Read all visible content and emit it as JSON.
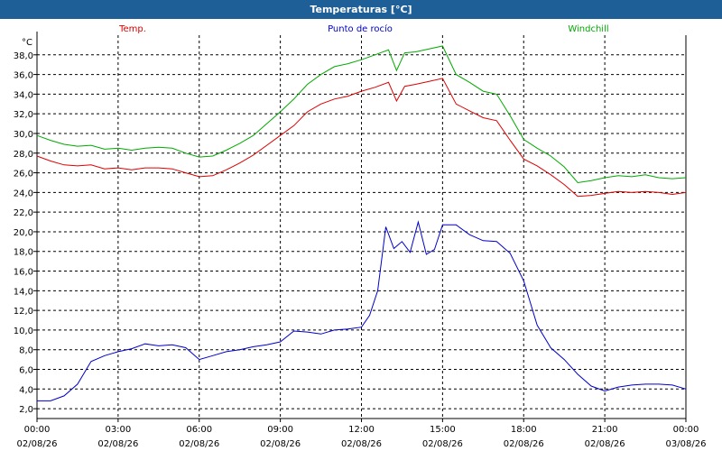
{
  "window": {
    "title": "Temperaturas [°C]"
  },
  "chart_data": {
    "type": "line",
    "unit_label": "°C",
    "ylim": [
      1,
      40
    ],
    "y_ticks": [
      2,
      4,
      6,
      8,
      10,
      12,
      14,
      16,
      18,
      20,
      22,
      24,
      26,
      28,
      30,
      32,
      34,
      36,
      38
    ],
    "y_tick_labels": [
      "2,0",
      "4,0",
      "6,0",
      "8,0",
      "10,0",
      "12,0",
      "14,0",
      "16,0",
      "18,0",
      "20,0",
      "22,0",
      "24,0",
      "26,0",
      "28,0",
      "30,0",
      "32,0",
      "34,0",
      "36,0",
      "38,0"
    ],
    "xlim": [
      0,
      24
    ],
    "x_ticks": [
      {
        "h": 0,
        "time": "00:00",
        "date": "02/08/26"
      },
      {
        "h": 3,
        "time": "03:00",
        "date": "02/08/26"
      },
      {
        "h": 6,
        "time": "06:00",
        "date": "02/08/26"
      },
      {
        "h": 9,
        "time": "09:00",
        "date": "02/08/26"
      },
      {
        "h": 12,
        "time": "12:00",
        "date": "02/08/26"
      },
      {
        "h": 15,
        "time": "15:00",
        "date": "02/08/26"
      },
      {
        "h": 18,
        "time": "18:00",
        "date": "02/08/26"
      },
      {
        "h": 21,
        "time": "21:00",
        "date": "02/08/26"
      },
      {
        "h": 24,
        "time": "00:00",
        "date": "03/08/26"
      }
    ],
    "grid": true,
    "series": [
      {
        "name": "Temp.",
        "color": "#dd0000",
        "points": [
          [
            0,
            27.7
          ],
          [
            0.5,
            27.2
          ],
          [
            1,
            26.8
          ],
          [
            1.5,
            26.7
          ],
          [
            2,
            26.8
          ],
          [
            2.5,
            26.4
          ],
          [
            3,
            26.5
          ],
          [
            3.5,
            26.3
          ],
          [
            4,
            26.5
          ],
          [
            4.5,
            26.5
          ],
          [
            5,
            26.4
          ],
          [
            5.5,
            26.0
          ],
          [
            6,
            25.6
          ],
          [
            6.5,
            25.7
          ],
          [
            7,
            26.3
          ],
          [
            7.5,
            27.0
          ],
          [
            8,
            27.8
          ],
          [
            8.5,
            28.8
          ],
          [
            9,
            29.8
          ],
          [
            9.5,
            30.8
          ],
          [
            10,
            32.2
          ],
          [
            10.5,
            33.0
          ],
          [
            11,
            33.5
          ],
          [
            11.5,
            33.8
          ],
          [
            12,
            34.3
          ],
          [
            12.5,
            34.7
          ],
          [
            13,
            35.2
          ],
          [
            13.3,
            33.3
          ],
          [
            13.6,
            34.8
          ],
          [
            14,
            35.0
          ],
          [
            14.5,
            35.3
          ],
          [
            15,
            35.6
          ],
          [
            15.5,
            33.0
          ],
          [
            16,
            32.3
          ],
          [
            16.5,
            31.6
          ],
          [
            17,
            31.3
          ],
          [
            17.5,
            29.3
          ],
          [
            18,
            27.4
          ],
          [
            18.5,
            26.7
          ],
          [
            19,
            25.8
          ],
          [
            19.5,
            24.8
          ],
          [
            20,
            23.6
          ],
          [
            20.5,
            23.7
          ],
          [
            21,
            23.9
          ],
          [
            21.5,
            24.1
          ],
          [
            22,
            24.0
          ],
          [
            22.5,
            24.1
          ],
          [
            23,
            24.0
          ],
          [
            23.5,
            23.8
          ],
          [
            24,
            24.0
          ]
        ]
      },
      {
        "name": "Punto de rocío",
        "color": "#0000cc",
        "points": [
          [
            0,
            2.8
          ],
          [
            0.5,
            2.8
          ],
          [
            1,
            3.3
          ],
          [
            1.5,
            4.5
          ],
          [
            2,
            6.8
          ],
          [
            2.5,
            7.4
          ],
          [
            3,
            7.8
          ],
          [
            3.5,
            8.1
          ],
          [
            4,
            8.6
          ],
          [
            4.5,
            8.4
          ],
          [
            5,
            8.5
          ],
          [
            5.5,
            8.2
          ],
          [
            6,
            7.0
          ],
          [
            6.5,
            7.4
          ],
          [
            7,
            7.8
          ],
          [
            7.5,
            8.0
          ],
          [
            8,
            8.3
          ],
          [
            8.5,
            8.5
          ],
          [
            9,
            8.8
          ],
          [
            9.5,
            9.9
          ],
          [
            10,
            9.8
          ],
          [
            10.5,
            9.6
          ],
          [
            11,
            10.0
          ],
          [
            11.5,
            10.1
          ],
          [
            12,
            10.3
          ],
          [
            12.3,
            11.5
          ],
          [
            12.6,
            14.0
          ],
          [
            12.9,
            20.5
          ],
          [
            13.2,
            18.3
          ],
          [
            13.5,
            19.0
          ],
          [
            13.8,
            17.9
          ],
          [
            14.1,
            21.0
          ],
          [
            14.4,
            17.7
          ],
          [
            14.7,
            18.2
          ],
          [
            15,
            20.7
          ],
          [
            15.5,
            20.7
          ],
          [
            16,
            19.7
          ],
          [
            16.5,
            19.1
          ],
          [
            17,
            19.0
          ],
          [
            17.5,
            17.8
          ],
          [
            18,
            15.0
          ],
          [
            18.5,
            10.5
          ],
          [
            19,
            8.2
          ],
          [
            19.5,
            7.0
          ],
          [
            20,
            5.5
          ],
          [
            20.5,
            4.3
          ],
          [
            21,
            3.8
          ],
          [
            21.5,
            4.2
          ],
          [
            22,
            4.4
          ],
          [
            22.5,
            4.5
          ],
          [
            23,
            4.5
          ],
          [
            23.5,
            4.4
          ],
          [
            24,
            4.0
          ]
        ]
      },
      {
        "name": "Windchill",
        "color": "#00aa00",
        "points": [
          [
            0,
            29.8
          ],
          [
            0.5,
            29.3
          ],
          [
            1,
            28.9
          ],
          [
            1.5,
            28.7
          ],
          [
            2,
            28.8
          ],
          [
            2.5,
            28.4
          ],
          [
            3,
            28.5
          ],
          [
            3.5,
            28.3
          ],
          [
            4,
            28.5
          ],
          [
            4.5,
            28.6
          ],
          [
            5,
            28.5
          ],
          [
            5.5,
            28.0
          ],
          [
            6,
            27.6
          ],
          [
            6.5,
            27.7
          ],
          [
            7,
            28.3
          ],
          [
            7.5,
            29.0
          ],
          [
            8,
            29.8
          ],
          [
            8.5,
            31.0
          ],
          [
            9,
            32.2
          ],
          [
            9.5,
            33.5
          ],
          [
            10,
            35.0
          ],
          [
            10.5,
            36.0
          ],
          [
            11,
            36.8
          ],
          [
            11.5,
            37.1
          ],
          [
            12,
            37.5
          ],
          [
            12.5,
            38.0
          ],
          [
            13,
            38.5
          ],
          [
            13.3,
            36.4
          ],
          [
            13.6,
            38.2
          ],
          [
            14,
            38.3
          ],
          [
            14.5,
            38.6
          ],
          [
            15,
            38.9
          ],
          [
            15.5,
            36.0
          ],
          [
            16,
            35.2
          ],
          [
            16.5,
            34.3
          ],
          [
            17,
            34.0
          ],
          [
            17.5,
            31.8
          ],
          [
            18,
            29.4
          ],
          [
            18.5,
            28.5
          ],
          [
            19,
            27.7
          ],
          [
            19.5,
            26.6
          ],
          [
            20,
            25.0
          ],
          [
            20.5,
            25.2
          ],
          [
            21,
            25.5
          ],
          [
            21.5,
            25.7
          ],
          [
            22,
            25.6
          ],
          [
            22.5,
            25.8
          ],
          [
            23,
            25.5
          ],
          [
            23.5,
            25.4
          ],
          [
            24,
            25.5
          ]
        ]
      }
    ]
  }
}
